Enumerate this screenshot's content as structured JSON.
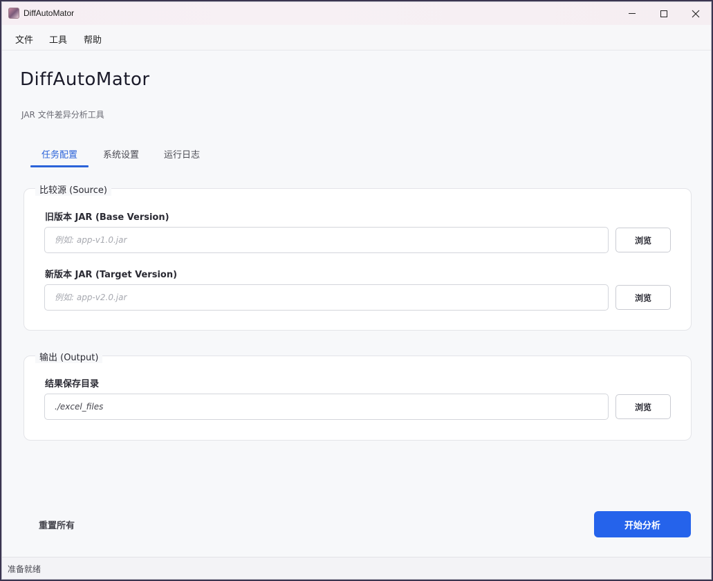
{
  "window": {
    "title": "DiffAutoMator"
  },
  "menu": {
    "items": [
      "文件",
      "工具",
      "帮助"
    ]
  },
  "header": {
    "title": "DiffAutoMator",
    "subtitle": "JAR 文件差异分析工具"
  },
  "tabs": [
    {
      "label": "任务配置",
      "active": true
    },
    {
      "label": "系统设置",
      "active": false
    },
    {
      "label": "运行日志",
      "active": false
    }
  ],
  "source_group": {
    "legend": "比较源 (Source)",
    "base": {
      "label": "旧版本 JAR (Base Version)",
      "placeholder": "例如: app-v1.0.jar",
      "value": "",
      "browse_label": "浏览"
    },
    "target": {
      "label": "新版本 JAR (Target Version)",
      "placeholder": "例如: app-v2.0.jar",
      "value": "",
      "browse_label": "浏览"
    }
  },
  "output_group": {
    "legend": "输出 (Output)",
    "dir": {
      "label": "结果保存目录",
      "value": "./excel_files",
      "browse_label": "浏览"
    }
  },
  "actions": {
    "reset_label": "重置所有",
    "start_label": "开始分析"
  },
  "status": {
    "text": "准备就绪"
  },
  "colors": {
    "accent": "#2563eb",
    "tab_active": "#2b63d9"
  }
}
